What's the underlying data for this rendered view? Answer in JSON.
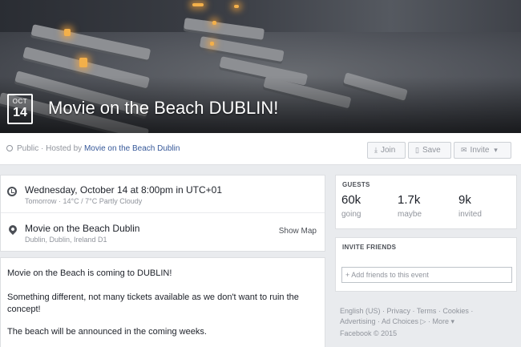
{
  "cover": {
    "date_month": "OCT",
    "date_day": "14",
    "title": "Movie on the Beach DUBLIN!"
  },
  "header": {
    "privacy": "Public",
    "hosted_by_prefix": "· Hosted by",
    "host": "Movie on the Beach Dublin",
    "join_label": "Join",
    "save_label": "Save",
    "invite_label": "Invite"
  },
  "when": {
    "main": "Wednesday, October 14 at 8:00pm in UTC+01",
    "sub": "Tomorrow · 14°C / 7°C Partly Cloudy"
  },
  "where": {
    "main": "Movie on the Beach Dublin",
    "sub": "Dublin, Dublin, Ireland D1",
    "show_map": "Show Map"
  },
  "description": {
    "p1": "Movie on the Beach is coming to DUBLIN!",
    "p2": "Something different, not many tickets available as we don't want to ruin the concept!",
    "p3": "The beach will be announced in the coming weeks."
  },
  "guests": {
    "title": "GUESTS",
    "going_count": "60k",
    "going_label": "going",
    "maybe_count": "1.7k",
    "maybe_label": "maybe",
    "invited_count": "9k",
    "invited_label": "invited"
  },
  "invite": {
    "title": "INVITE FRIENDS",
    "placeholder": "+ Add friends to this event"
  },
  "footer": {
    "line1": "English (US) · Privacy · Terms · Cookies ·",
    "line2": "Advertising · Ad Choices ▷ · More ▾",
    "line3": "Facebook © 2015"
  },
  "colors": {
    "link": "#365899",
    "muted": "#90949c",
    "background": "#e9ebee"
  }
}
